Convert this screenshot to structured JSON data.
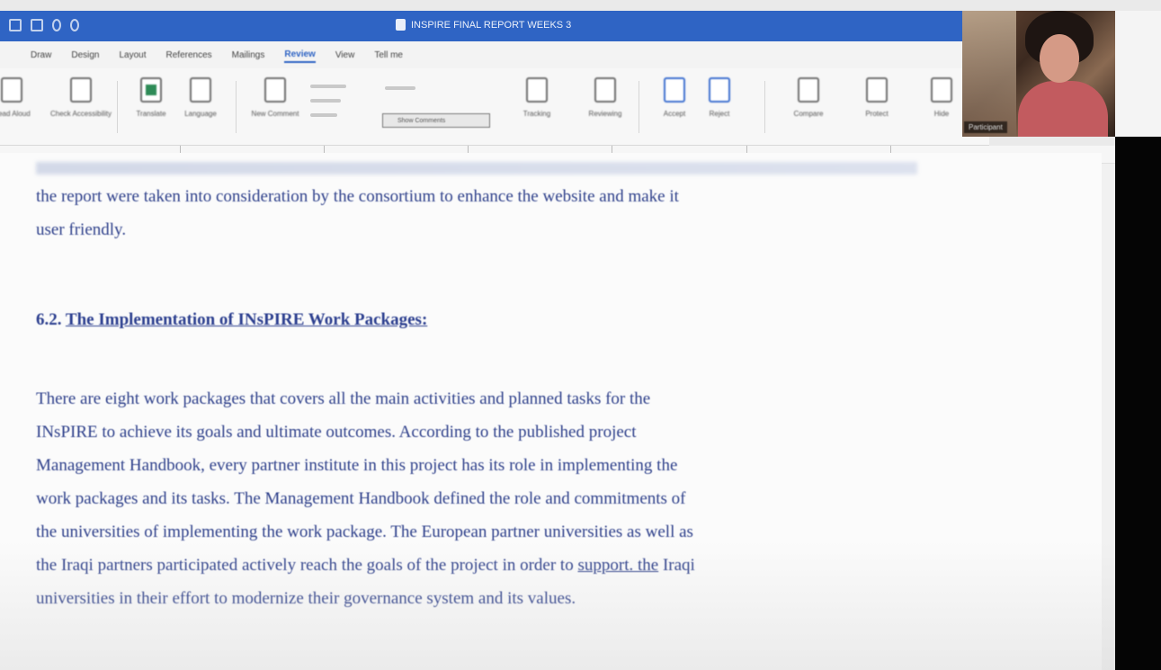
{
  "titlebar": {
    "document_title": "INSPIRE FINAL REPORT WEEKS 3"
  },
  "tabs": [
    "Draw",
    "Design",
    "Layout",
    "References",
    "Mailings",
    "Review",
    "View",
    "Tell me"
  ],
  "ribbon": {
    "groups": [
      "Read Aloud",
      "Check Accessibility",
      "Translate",
      "Language",
      "New Comment",
      "Tracking",
      "Reviewing",
      "Accept",
      "Reject",
      "Compare",
      "Protect",
      "Hide"
    ],
    "show_comments": "Show Comments"
  },
  "webcam": {
    "participant_name": "Participant"
  },
  "document": {
    "para1": [
      "the report were taken into consideration by the consortium to enhance the website and make it",
      "user friendly."
    ],
    "heading_number": "6.2.",
    "heading_text": "The Implementation of INsPIRE Work Packages:",
    "para2": [
      "There are eight work packages that covers all the main activities and planned tasks for the",
      "INsPIRE to achieve its goals and ultimate outcomes. According to the published project",
      "Management Handbook, every partner institute in this project has its role in implementing the",
      "work packages and its tasks. The Management Handbook defined the role and commitments of",
      "the universities of implementing the work package. The European partner universities as well as"
    ],
    "para2_line6_pre": "the Iraqi partners participated actively reach the goals of the project in order to ",
    "para2_line6_link": "support. the",
    "para2_line6_post": " Iraqi",
    "para2_line7": "universities in their effort to modernize their governance system and its values."
  }
}
